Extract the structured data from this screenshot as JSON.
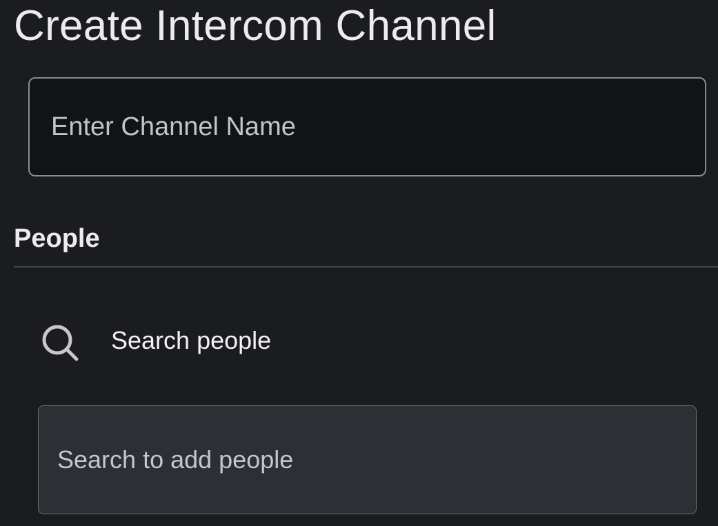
{
  "page": {
    "title": "Create Intercom Channel"
  },
  "channel_name": {
    "placeholder": "Enter Channel Name",
    "value": ""
  },
  "people_section": {
    "title": "People",
    "search_row": {
      "icon": "search-icon",
      "label": "Search people"
    },
    "add_input": {
      "placeholder": "Search to add people",
      "value": ""
    }
  },
  "colors": {
    "background": "#1b1c20",
    "input_dark": "#111316",
    "input_mid": "#2d2f34",
    "text": "#ececec",
    "icon": "#c9c6cf",
    "divider": "#45474c"
  }
}
